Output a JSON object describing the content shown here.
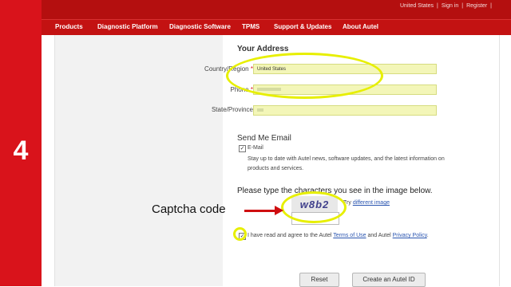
{
  "step": {
    "number": "4"
  },
  "top_links": {
    "region": "United States",
    "sign_in": "Sign in",
    "register": "Register"
  },
  "nav": {
    "items": [
      {
        "label": "Products"
      },
      {
        "label": "Diagnostic Platform"
      },
      {
        "label": "Diagnostic Software"
      },
      {
        "label": "TPMS"
      },
      {
        "label": "Support & Updates"
      },
      {
        "label": "About Autel"
      }
    ]
  },
  "address": {
    "title": "Your Address",
    "country_label": "Country/Region",
    "country_value": "United States",
    "phone_label": "Phone",
    "state_label": "State/Province",
    "required_mark": "*"
  },
  "email": {
    "title": "Send Me Email",
    "checkbox_label": "E-Mail",
    "description_line1": "Stay up to date with Autel news, software updates, and the latest information on",
    "description_line2": "products and services."
  },
  "captcha": {
    "title": "Please type the characters you see in the image below.",
    "image_text": "w8b2",
    "try_prefix": "Try",
    "try_link": "different image"
  },
  "agree": {
    "text_before": "I have read and agree to the Autel",
    "terms_link": "Terms of Use",
    "and_text": "and Autel",
    "privacy_link": "Privacy Policy",
    "end": "."
  },
  "buttons": {
    "reset": "Reset",
    "create": "Create an Autel ID"
  },
  "annotation": {
    "captcha_label": "Captcha code",
    "highlight_color": "#e7ef00",
    "arrow_color": "#cf0e10"
  },
  "colors": {
    "step_red": "#d9131b",
    "nav_red": "#c31212",
    "input_yellow": "#f3f6b8"
  }
}
